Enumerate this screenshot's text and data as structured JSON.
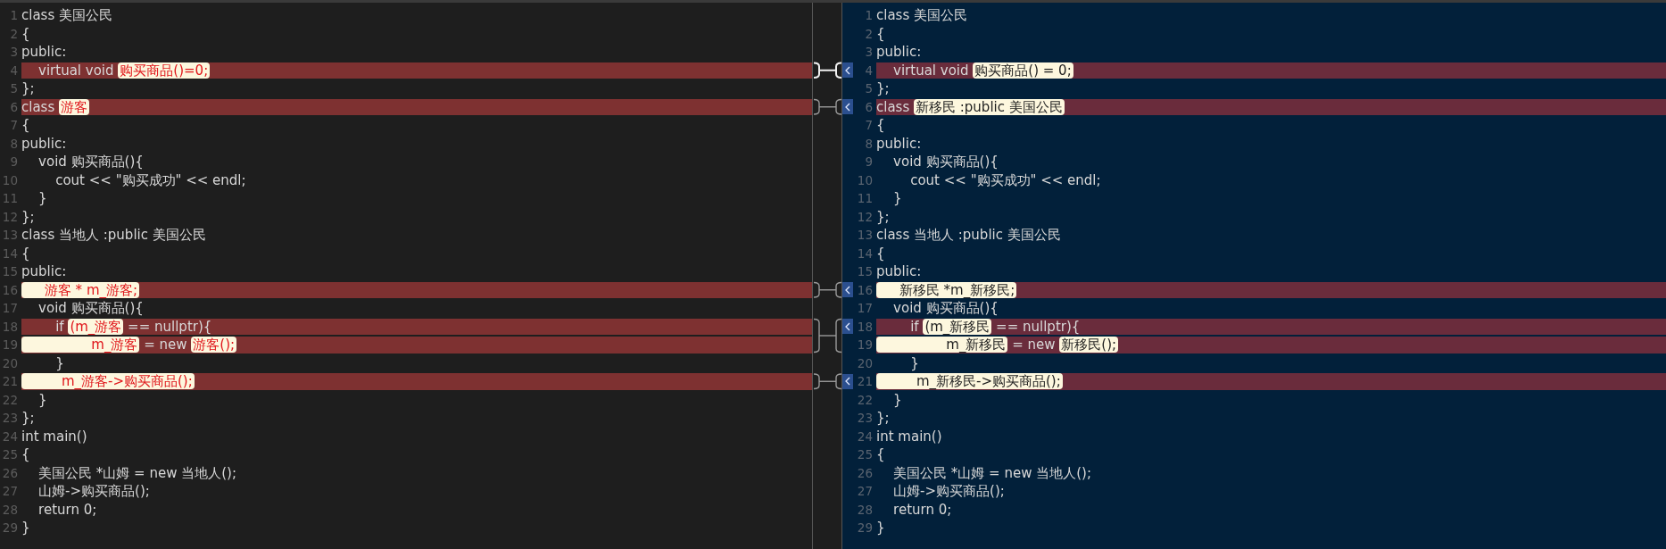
{
  "panes": [
    {
      "lines": [
        {
          "number": "1",
          "changed": false,
          "segments": [
            {
              "text": "class 美国公民",
              "highlight": false
            }
          ]
        },
        {
          "number": "2",
          "changed": false,
          "segments": [
            {
              "text": "{",
              "highlight": false
            }
          ]
        },
        {
          "number": "3",
          "changed": false,
          "segments": [
            {
              "text": "public:",
              "highlight": false
            }
          ]
        },
        {
          "number": "4",
          "changed": true,
          "segments": [
            {
              "text": "    virtual void ",
              "highlight": false
            },
            {
              "text": "购买商品()=0;",
              "highlight": true
            }
          ]
        },
        {
          "number": "5",
          "changed": false,
          "segments": [
            {
              "text": "};",
              "highlight": false
            }
          ]
        },
        {
          "number": "6",
          "changed": true,
          "segments": [
            {
              "text": "class ",
              "highlight": false
            },
            {
              "text": "游客",
              "highlight": true
            }
          ]
        },
        {
          "number": "7",
          "changed": false,
          "segments": [
            {
              "text": "{",
              "highlight": false
            }
          ]
        },
        {
          "number": "8",
          "changed": false,
          "segments": [
            {
              "text": "public:",
              "highlight": false
            }
          ]
        },
        {
          "number": "9",
          "changed": false,
          "segments": [
            {
              "text": "    void 购买商品(){",
              "highlight": false
            }
          ]
        },
        {
          "number": "10",
          "changed": false,
          "segments": [
            {
              "text": "        cout << \"购买成功\" << endl;",
              "highlight": false
            }
          ]
        },
        {
          "number": "11",
          "changed": false,
          "segments": [
            {
              "text": "    }",
              "highlight": false
            }
          ]
        },
        {
          "number": "12",
          "changed": false,
          "segments": [
            {
              "text": "};",
              "highlight": false
            }
          ]
        },
        {
          "number": "13",
          "changed": false,
          "segments": [
            {
              "text": "class 当地人 :public 美国公民",
              "highlight": false
            }
          ]
        },
        {
          "number": "14",
          "changed": false,
          "segments": [
            {
              "text": "{",
              "highlight": false
            }
          ]
        },
        {
          "number": "15",
          "changed": false,
          "segments": [
            {
              "text": "public:",
              "highlight": false
            }
          ]
        },
        {
          "number": "16",
          "changed": true,
          "segments": [
            {
              "text": "     游客 * m_游客;",
              "highlight": true
            }
          ]
        },
        {
          "number": "17",
          "changed": false,
          "segments": [
            {
              "text": "    void 购买商品(){",
              "highlight": false
            }
          ]
        },
        {
          "number": "18",
          "changed": true,
          "segments": [
            {
              "text": "        if ",
              "highlight": false
            },
            {
              "text": "(m_游客",
              "highlight": true
            },
            {
              "text": " == nullptr){",
              "highlight": false
            }
          ]
        },
        {
          "number": "19",
          "changed": true,
          "segments": [
            {
              "text": "                m_游客",
              "highlight": true
            },
            {
              "text": " = new ",
              "highlight": false
            },
            {
              "text": "游客();",
              "highlight": true
            }
          ]
        },
        {
          "number": "20",
          "changed": false,
          "segments": [
            {
              "text": "        }",
              "highlight": false
            }
          ]
        },
        {
          "number": "21",
          "changed": true,
          "segments": [
            {
              "text": "         m_游客->购买商品();",
              "highlight": true
            }
          ]
        },
        {
          "number": "22",
          "changed": false,
          "segments": [
            {
              "text": "    }",
              "highlight": false
            }
          ]
        },
        {
          "number": "23",
          "changed": false,
          "segments": [
            {
              "text": "};",
              "highlight": false
            }
          ]
        },
        {
          "number": "24",
          "changed": false,
          "segments": [
            {
              "text": "int main()",
              "highlight": false
            }
          ]
        },
        {
          "number": "25",
          "changed": false,
          "segments": [
            {
              "text": "{",
              "highlight": false
            }
          ]
        },
        {
          "number": "26",
          "changed": false,
          "segments": [
            {
              "text": "    美国公民 *山姆 = new 当地人();",
              "highlight": false
            }
          ]
        },
        {
          "number": "27",
          "changed": false,
          "segments": [
            {
              "text": "    山姆->购买商品();",
              "highlight": false
            }
          ]
        },
        {
          "number": "28",
          "changed": false,
          "segments": [
            {
              "text": "    return 0;",
              "highlight": false
            }
          ]
        },
        {
          "number": "29",
          "changed": false,
          "segments": [
            {
              "text": "}",
              "highlight": false
            }
          ]
        }
      ]
    },
    {
      "lines": [
        {
          "number": "1",
          "changed": false,
          "segments": [
            {
              "text": "class 美国公民",
              "highlight": false
            }
          ]
        },
        {
          "number": "2",
          "changed": false,
          "segments": [
            {
              "text": "{",
              "highlight": false
            }
          ]
        },
        {
          "number": "3",
          "changed": false,
          "segments": [
            {
              "text": "public:",
              "highlight": false
            }
          ]
        },
        {
          "number": "4",
          "changed": true,
          "segments": [
            {
              "text": "    virtual void ",
              "highlight": false
            },
            {
              "text": "购买商品() = 0;",
              "highlight": true
            }
          ]
        },
        {
          "number": "5",
          "changed": false,
          "segments": [
            {
              "text": "};",
              "highlight": false
            }
          ]
        },
        {
          "number": "6",
          "changed": true,
          "segments": [
            {
              "text": "class ",
              "highlight": false
            },
            {
              "text": "新移民 :public 美国公民",
              "highlight": true
            }
          ]
        },
        {
          "number": "7",
          "changed": false,
          "segments": [
            {
              "text": "{",
              "highlight": false
            }
          ]
        },
        {
          "number": "8",
          "changed": false,
          "segments": [
            {
              "text": "public:",
              "highlight": false
            }
          ]
        },
        {
          "number": "9",
          "changed": false,
          "segments": [
            {
              "text": "    void 购买商品(){",
              "highlight": false
            }
          ]
        },
        {
          "number": "10",
          "changed": false,
          "segments": [
            {
              "text": "        cout << \"购买成功\" << endl;",
              "highlight": false
            }
          ]
        },
        {
          "number": "11",
          "changed": false,
          "segments": [
            {
              "text": "    }",
              "highlight": false
            }
          ]
        },
        {
          "number": "12",
          "changed": false,
          "segments": [
            {
              "text": "};",
              "highlight": false
            }
          ]
        },
        {
          "number": "13",
          "changed": false,
          "segments": [
            {
              "text": "class 当地人 :public 美国公民",
              "highlight": false
            }
          ]
        },
        {
          "number": "14",
          "changed": false,
          "segments": [
            {
              "text": "{",
              "highlight": false
            }
          ]
        },
        {
          "number": "15",
          "changed": false,
          "segments": [
            {
              "text": "public:",
              "highlight": false
            }
          ]
        },
        {
          "number": "16",
          "changed": true,
          "segments": [
            {
              "text": "     新移民 *m_新移民;",
              "highlight": true
            }
          ]
        },
        {
          "number": "17",
          "changed": false,
          "segments": [
            {
              "text": "    void 购买商品(){",
              "highlight": false
            }
          ]
        },
        {
          "number": "18",
          "changed": true,
          "segments": [
            {
              "text": "        if ",
              "highlight": false
            },
            {
              "text": "(m_新移民",
              "highlight": true
            },
            {
              "text": " == nullptr){",
              "highlight": false
            }
          ]
        },
        {
          "number": "19",
          "changed": true,
          "segments": [
            {
              "text": "                m_新移民",
              "highlight": true
            },
            {
              "text": " = new ",
              "highlight": false
            },
            {
              "text": "新移民();",
              "highlight": true
            }
          ]
        },
        {
          "number": "20",
          "changed": false,
          "segments": [
            {
              "text": "        }",
              "highlight": false
            }
          ]
        },
        {
          "number": "21",
          "changed": true,
          "segments": [
            {
              "text": "         m_新移民->购买商品();",
              "highlight": true
            }
          ]
        },
        {
          "number": "22",
          "changed": false,
          "segments": [
            {
              "text": "    }",
              "highlight": false
            }
          ]
        },
        {
          "number": "23",
          "changed": false,
          "segments": [
            {
              "text": "};",
              "highlight": false
            }
          ]
        },
        {
          "number": "24",
          "changed": false,
          "segments": [
            {
              "text": "int main()",
              "highlight": false
            }
          ]
        },
        {
          "number": "25",
          "changed": false,
          "segments": [
            {
              "text": "{",
              "highlight": false
            }
          ]
        },
        {
          "number": "26",
          "changed": false,
          "segments": [
            {
              "text": "    美国公民 *山姆 = new 当地人();",
              "highlight": false
            }
          ]
        },
        {
          "number": "27",
          "changed": false,
          "segments": [
            {
              "text": "    山姆->购买商品();",
              "highlight": false
            }
          ]
        },
        {
          "number": "28",
          "changed": false,
          "segments": [
            {
              "text": "    return 0;",
              "highlight": false
            }
          ]
        },
        {
          "number": "29",
          "changed": false,
          "segments": [
            {
              "text": "}",
              "highlight": false
            }
          ]
        }
      ]
    }
  ],
  "blocks": [
    {
      "selected": true
    },
    {
      "selected": false
    },
    {
      "selected": false
    },
    {
      "selected": false
    },
    {
      "selected": false
    }
  ]
}
